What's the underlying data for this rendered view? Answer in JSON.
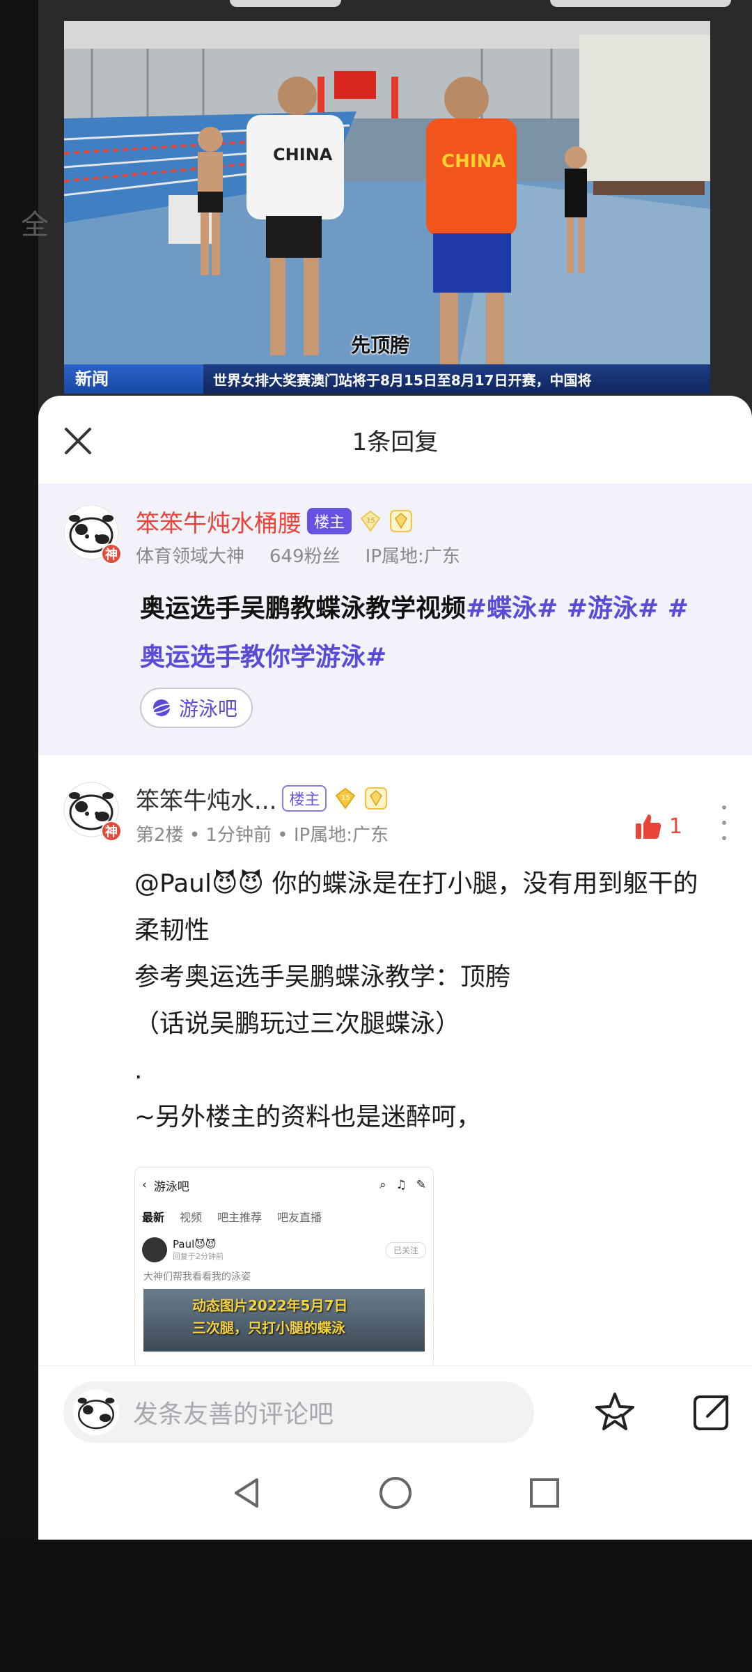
{
  "video": {
    "news_tag": "新闻",
    "ticker": "世界女排大奖赛澳门站将于8月15日至8月17日开赛，中国将",
    "caption": "先顶胯",
    "shirt_text": "CHINA"
  },
  "sheet": {
    "title": "1条回复",
    "close_icon": "close-icon"
  },
  "main_post": {
    "author": "笨笨牛炖水桶腰",
    "badge": "楼主",
    "level": "15",
    "avatar_badge": "神",
    "role": "体育领域大神",
    "fans": "649粉丝",
    "ip": "IP属地:广东",
    "title_text": "奥运选手吴鹏教蝶泳教学视频",
    "hashtags": "#蝶泳# #游泳# #",
    "hashtag_line2": "奥运选手教你学游泳#",
    "forum": "游泳吧"
  },
  "reply": {
    "author": "笨笨牛炖水...",
    "badge": "楼主",
    "level": "15",
    "avatar_badge": "神",
    "floor": "第2楼",
    "time": "1分钟前",
    "ip": "IP属地:广东",
    "likes": "1",
    "lines": [
      "@Paul😈😈 你的蝶泳是在打小腿，没有用到躯干的柔韧性",
      "参考奥运选手吴鹏蝶泳教学：顶胯",
      "（话说吴鹏玩过三次腿蝶泳）",
      ".",
      "~另外楼主的资料也是迷醉呵，"
    ]
  },
  "thumbnail": {
    "title": "游泳吧",
    "tabs": [
      "最新",
      "视频",
      "吧主推荐",
      "吧友直播"
    ],
    "user": "Paul😈😈",
    "user_time": "回复于2分钟前",
    "follow": "已关注",
    "line": "大神们帮我看看我的泳姿",
    "img_line1": "动态图片2022年5月7日",
    "img_line2": "三次腿，只打小腿的蝶泳"
  },
  "comment_bar": {
    "placeholder": "发条友善的评论吧"
  },
  "colors": {
    "accent_purple": "#5a4ad6",
    "name_red": "#e8443a",
    "sheet_bg": "#ffffff",
    "post_bg": "#f2f2fa"
  }
}
